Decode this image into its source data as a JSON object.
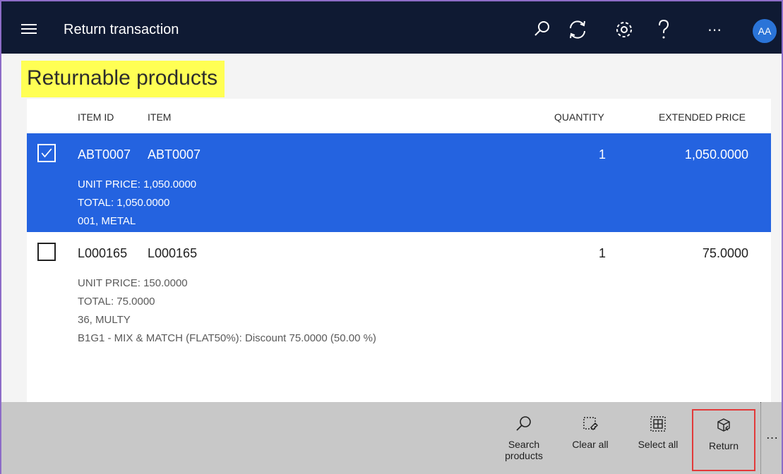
{
  "header": {
    "title": "Return transaction",
    "avatar_initials": "AA",
    "more_label": "……"
  },
  "heading": "Returnable products",
  "columns": {
    "item_id": "ITEM ID",
    "item": "ITEM",
    "quantity": "QUANTITY",
    "extended_price": "EXTENDED PRICE"
  },
  "rows": [
    {
      "selected": true,
      "item_id": "ABT0007",
      "item": "ABT0007",
      "quantity": "1",
      "extended_price": "1,050.0000",
      "details": [
        "UNIT PRICE: 1,050.0000",
        "TOTAL: 1,050.0000",
        "001, METAL"
      ]
    },
    {
      "selected": false,
      "item_id": "L000165",
      "item": "L000165",
      "quantity": "1",
      "extended_price": "75.0000",
      "details": [
        "UNIT PRICE: 150.0000",
        "TOTAL: 75.0000",
        "36, MULTY",
        "B1G1 - MIX & MATCH (FLAT50%): Discount 75.0000 (50.00 %)"
      ]
    }
  ],
  "actions": {
    "search_line1": "Search",
    "search_line2": "products",
    "clear_all": "Clear all",
    "select_all": "Select all",
    "return": "Return",
    "overflow": "…"
  },
  "colors": {
    "topbar": "#0f1a33",
    "selected_row": "#2463e0",
    "highlight": "#ffff54",
    "return_outline": "#e23a3a",
    "actionbar": "#c8c8c8"
  }
}
